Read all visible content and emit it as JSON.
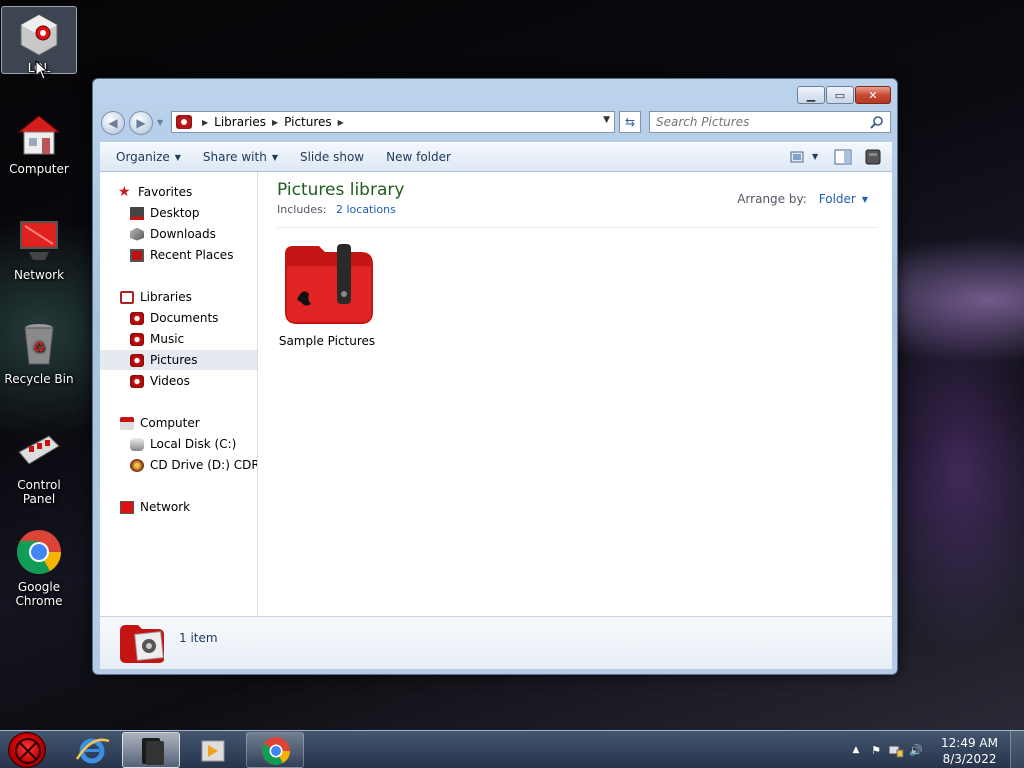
{
  "desktop": {
    "icons": [
      {
        "label": "LOL",
        "icon": "lol-app-icon"
      },
      {
        "label": "Computer",
        "icon": "computer-icon"
      },
      {
        "label": "Network",
        "icon": "network-icon"
      },
      {
        "label": "Recycle Bin",
        "icon": "recycle-bin-icon"
      },
      {
        "label": "Control Panel",
        "icon": "control-panel-icon"
      },
      {
        "label": "Google Chrome",
        "icon": "chrome-icon"
      }
    ]
  },
  "window": {
    "controls": {
      "minimize": "minimize-icon",
      "maximize": "maximize-icon",
      "close": "close-icon"
    },
    "address": {
      "crumbs": [
        "Libraries",
        "Pictures"
      ]
    },
    "search": {
      "placeholder": "Search Pictures"
    },
    "toolbar": {
      "organize": "Organize",
      "share_with": "Share with",
      "slide_show": "Slide show",
      "new_folder": "New folder"
    },
    "nav": {
      "favorites": "Favorites",
      "desktop": "Desktop",
      "downloads": "Downloads",
      "recent_places": "Recent Places",
      "libraries": "Libraries",
      "documents": "Documents",
      "music": "Music",
      "pictures": "Pictures",
      "videos": "Videos",
      "computer": "Computer",
      "local_disk": "Local Disk (C:)",
      "cd_drive": "CD Drive (D:) CDROM",
      "network": "Network"
    },
    "main": {
      "title": "Pictures library",
      "includes_label": "Includes:",
      "includes_link": "2 locations",
      "arrange_label": "Arrange by:",
      "arrange_value": "Folder",
      "items": [
        {
          "label": "Sample Pictures"
        }
      ]
    },
    "details": {
      "count": "1 item"
    }
  },
  "taskbar": {
    "time": "12:49 AM",
    "date": "8/3/2022"
  },
  "colors": {
    "accent_red": "#c40000",
    "library_title": "#1e5e1e",
    "link_blue": "#1f5db5"
  }
}
